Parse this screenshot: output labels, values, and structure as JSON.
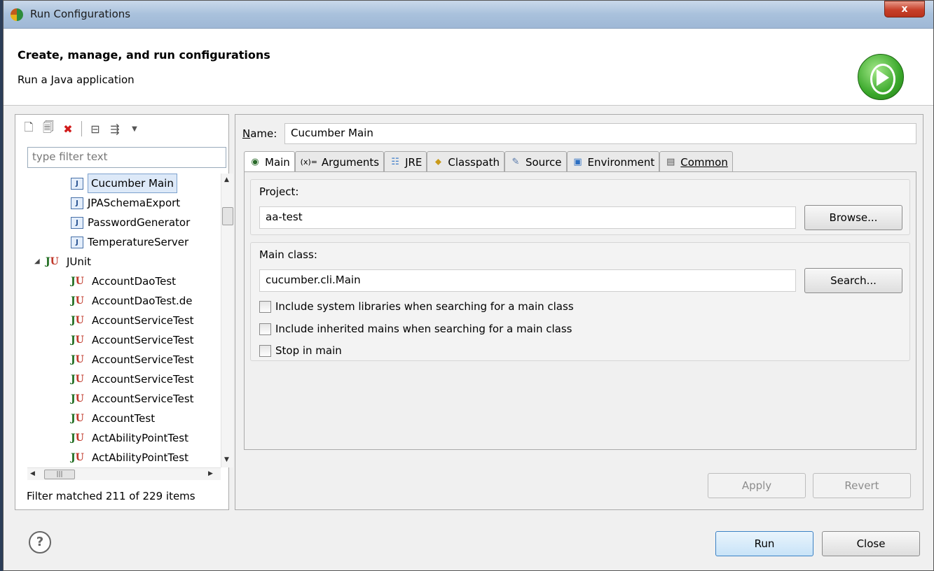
{
  "window": {
    "title": "Run Configurations",
    "close_glyph": "x"
  },
  "header": {
    "title": "Create, manage, and run configurations",
    "subtitle": "Run a Java application"
  },
  "left": {
    "filter_placeholder": "type filter text",
    "tree": [
      {
        "label": "Cucumber Main",
        "type": "java-app",
        "selected": true
      },
      {
        "label": "JPASchemaExport",
        "type": "java-app"
      },
      {
        "label": "PasswordGenerator",
        "type": "java-app"
      },
      {
        "label": "TemperatureServer",
        "type": "java-app"
      },
      {
        "label": "JUnit",
        "type": "junit-category"
      },
      {
        "label": "AccountDaoTest",
        "type": "junit"
      },
      {
        "label": "AccountDaoTest.de",
        "type": "junit"
      },
      {
        "label": "AccountServiceTest",
        "type": "junit"
      },
      {
        "label": "AccountServiceTest",
        "type": "junit"
      },
      {
        "label": "AccountServiceTest",
        "type": "junit"
      },
      {
        "label": "AccountServiceTest",
        "type": "junit"
      },
      {
        "label": "AccountServiceTest",
        "type": "junit"
      },
      {
        "label": "AccountTest",
        "type": "junit"
      },
      {
        "label": "ActAbilityPointTest",
        "type": "junit"
      },
      {
        "label": "ActAbilityPointTest",
        "type": "junit"
      }
    ],
    "status": "Filter matched 211 of 229 items"
  },
  "right": {
    "name_label": "Name:",
    "name_value": "Cucumber Main",
    "tabs": [
      {
        "label": "Main",
        "icon": "main-icon"
      },
      {
        "label": "Arguments",
        "icon": "arguments-icon"
      },
      {
        "label": "JRE",
        "icon": "jre-icon"
      },
      {
        "label": "Classpath",
        "icon": "classpath-icon"
      },
      {
        "label": "Source",
        "icon": "source-icon"
      },
      {
        "label": "Environment",
        "icon": "environment-icon"
      },
      {
        "label": "Common",
        "icon": "common-icon"
      }
    ],
    "project": {
      "label": "Project:",
      "value": "aa-test",
      "button": "Browse..."
    },
    "main_class": {
      "label": "Main class:",
      "value": "cucumber.cli.Main",
      "button": "Search..."
    },
    "options": [
      "Include system libraries when searching for a main class",
      "Include inherited mains when searching for a main class",
      "Stop in main"
    ],
    "apply": "Apply",
    "revert": "Revert"
  },
  "footer": {
    "run": "Run",
    "close": "Close"
  }
}
